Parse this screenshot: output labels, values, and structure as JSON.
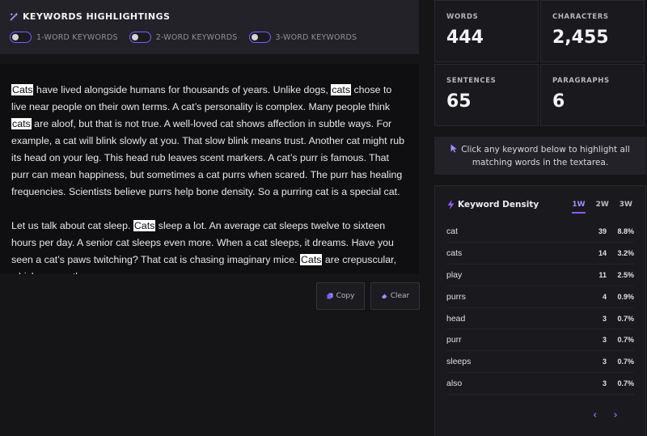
{
  "highlight": {
    "title": "KEYWORDS HIGHLIGHTINGS",
    "toggles": [
      {
        "label": "1-WORD KEYWORDS",
        "on": false
      },
      {
        "label": "2-WORD KEYWORDS",
        "on": false
      },
      {
        "label": "3-WORD KEYWORDS",
        "on": false
      }
    ]
  },
  "editor": {
    "paragraphs": [
      [
        {
          "t": "Cats",
          "hl": true
        },
        {
          "t": " have lived alongside humans for thousands of years. Unlike dogs, "
        },
        {
          "t": "cats",
          "hl": true
        },
        {
          "t": " chose to live near people on their own terms. A cat’s personality is complex. Many people think "
        },
        {
          "t": "cats",
          "hl": true
        },
        {
          "t": " are aloof, but that is not true. A well-loved cat shows affection in subtle ways. For example, a cat will blink slowly at you. That slow blink means trust. Another cat might rub its head on your leg. This head rub leaves scent markers. A cat’s purr is famous. That purr can mean happiness, but sometimes a cat purrs when scared. The purr has healing frequencies. Scientists believe purrs help bone density. So a purring cat is a special cat."
        }
      ],
      [
        {
          "t": "Let us talk about cat sleep. "
        },
        {
          "t": "Cats",
          "hl": true
        },
        {
          "t": " sleep a lot. An average cat sleeps twelve to sixteen hours per day. A senior cat sleeps even more. When a cat sleeps, it dreams. Have you seen a cat’s paws twitching? That cat is chasing imaginary mice. "
        },
        {
          "t": "Cats",
          "hl": true
        },
        {
          "t": " are crepuscular, which means they are"
        }
      ]
    ],
    "copy_label": "Copy",
    "clear_label": "Clear"
  },
  "stats": {
    "words_label": "WORDS",
    "words": "444",
    "characters_label": "CHARACTERS",
    "characters": "2,455",
    "sentences_label": "SENTENCES",
    "sentences": "65",
    "paragraphs_label": "PARAGRAPHS",
    "paragraphs": "6"
  },
  "hint": "Click any keyword below to highlight all matching words in the textarea.",
  "density": {
    "title": "Keyword Density",
    "tabs": [
      "1W",
      "2W",
      "3W"
    ],
    "active_tab": "1W",
    "rows": [
      {
        "kw": "cat",
        "count": "39",
        "pct": "8.8%"
      },
      {
        "kw": "cats",
        "count": "14",
        "pct": "3.2%"
      },
      {
        "kw": "play",
        "count": "11",
        "pct": "2.5%"
      },
      {
        "kw": "purrs",
        "count": "4",
        "pct": "0.9%"
      },
      {
        "kw": "head",
        "count": "3",
        "pct": "0.7%"
      },
      {
        "kw": "purr",
        "count": "3",
        "pct": "0.7%"
      },
      {
        "kw": "sleeps",
        "count": "3",
        "pct": "0.7%"
      },
      {
        "kw": "also",
        "count": "3",
        "pct": "0.7%"
      }
    ],
    "prev": "‹",
    "next": "›"
  },
  "colors": {
    "accent": "#8b5cf6",
    "highlight_bg": "#ffffff"
  }
}
